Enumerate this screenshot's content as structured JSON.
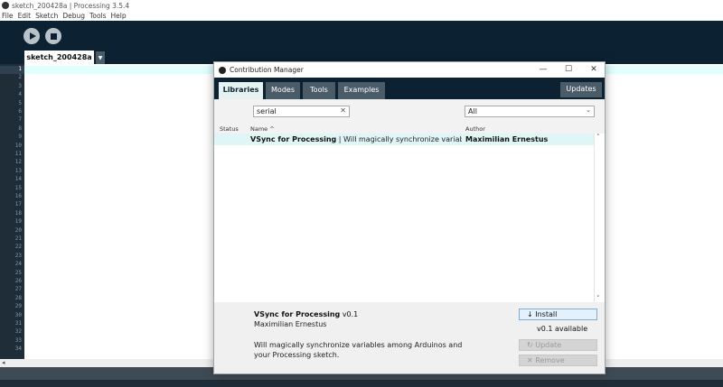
{
  "main_window": {
    "title": "sketch_200428a | Processing 3.5.4",
    "menu": [
      "File",
      "Edit",
      "Sketch",
      "Debug",
      "Tools",
      "Help"
    ],
    "sketch_tab": "sketch_200428a",
    "tab_menu_glyph": "▼",
    "line_numbers": [
      "1",
      "2",
      "3",
      "4",
      "5",
      "6",
      "7",
      "8",
      "9",
      "10",
      "11",
      "12",
      "13",
      "14",
      "15",
      "16",
      "17",
      "18",
      "19",
      "20",
      "21",
      "22",
      "23",
      "24",
      "25",
      "26",
      "27",
      "28",
      "29",
      "30",
      "31",
      "32",
      "33",
      "34"
    ],
    "icons": {
      "run": "play-icon",
      "stop": "stop-icon"
    },
    "colors": {
      "toolbar": "#0c2233",
      "gutter": "#1e2d38",
      "current_line": "#e0fffd"
    }
  },
  "dialog": {
    "title": "Contribution Manager",
    "window_controls": {
      "minimize": "—",
      "maximize": "☐",
      "close": "✕"
    },
    "tabs": [
      "Libraries",
      "Modes",
      "Tools",
      "Examples"
    ],
    "active_tab": "Libraries",
    "updates_label": "Updates",
    "search_value": "serial",
    "search_clear": "✕",
    "category_value": "All",
    "columns": {
      "status": "Status",
      "name": "Name",
      "name_sort": "^",
      "author": "Author"
    },
    "rows": [
      {
        "name": "VSync for Processing",
        "separator": " | ",
        "description": "Will magically synchronize variables am...",
        "author": "Maximilian Ernestus"
      }
    ],
    "details": {
      "name": "VSync for Processing",
      "version": "v0.1",
      "author": "Maximilian Ernestus",
      "description": "Will magically synchronize variables among Arduinos and your Processing sketch.",
      "install_label": "↓  Install",
      "available_label": "v0.1 available",
      "update_label": "↻  Update",
      "remove_label": "✕  Remove"
    }
  }
}
